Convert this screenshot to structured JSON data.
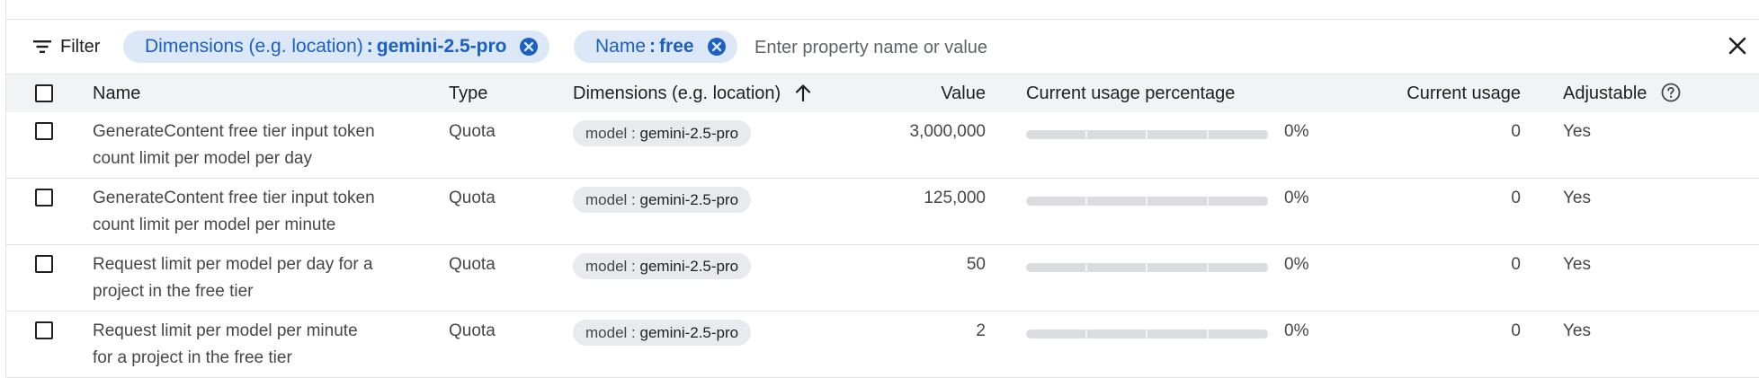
{
  "filter": {
    "button_label": "Filter",
    "chips": [
      {
        "key": "Dimensions (e.g. location)",
        "sep": ":",
        "value": "gemini-2.5-pro"
      },
      {
        "key": "Name",
        "sep": ":",
        "value": "free"
      }
    ],
    "input_placeholder": "Enter property name or value"
  },
  "table": {
    "headers": {
      "name": "Name",
      "type": "Type",
      "dimensions": "Dimensions (e.g. location)",
      "value": "Value",
      "usage_percentage": "Current usage percentage",
      "current_usage": "Current usage",
      "adjustable": "Adjustable"
    },
    "sort_indicator": "arrow-up-icon",
    "rows": [
      {
        "name_line1": "GenerateContent free tier input token",
        "name_line2": "count limit per model per day",
        "type": "Quota",
        "dim_key": "model",
        "dim_sep": ":",
        "dim_value": "gemini-2.5-pro",
        "value": "3,000,000",
        "usage_fraction": 0,
        "percentage": "0%",
        "current_usage": "0",
        "adjustable": "Yes"
      },
      {
        "name_line1": "GenerateContent free tier input token",
        "name_line2": "count limit per model per minute",
        "type": "Quota",
        "dim_key": "model",
        "dim_sep": ":",
        "dim_value": "gemini-2.5-pro",
        "value": "125,000",
        "usage_fraction": 0,
        "percentage": "0%",
        "current_usage": "0",
        "adjustable": "Yes"
      },
      {
        "name_line1": "Request limit per model per day for a",
        "name_line2": "project in the free tier",
        "type": "Quota",
        "dim_key": "model",
        "dim_sep": ":",
        "dim_value": "gemini-2.5-pro",
        "value": "50",
        "usage_fraction": 0,
        "percentage": "0%",
        "current_usage": "0",
        "adjustable": "Yes"
      },
      {
        "name_line1": "Request limit per model per minute",
        "name_line2": "for a project in the free tier",
        "type": "Quota",
        "dim_key": "model",
        "dim_sep": ":",
        "dim_value": "gemini-2.5-pro",
        "value": "2",
        "usage_fraction": 0,
        "percentage": "0%",
        "current_usage": "0",
        "adjustable": "Yes"
      }
    ]
  },
  "colors": {
    "chip_background": "#dce8f8",
    "chip_text": "#1a5fc2",
    "header_background": "#f1f3f4",
    "bar_track": "#dadce0",
    "bar_fill": "#1a73e8"
  },
  "icons": [
    "filter-list-icon",
    "chip-remove-icon",
    "close-icon",
    "arrow-up-icon",
    "help-circle-icon"
  ]
}
